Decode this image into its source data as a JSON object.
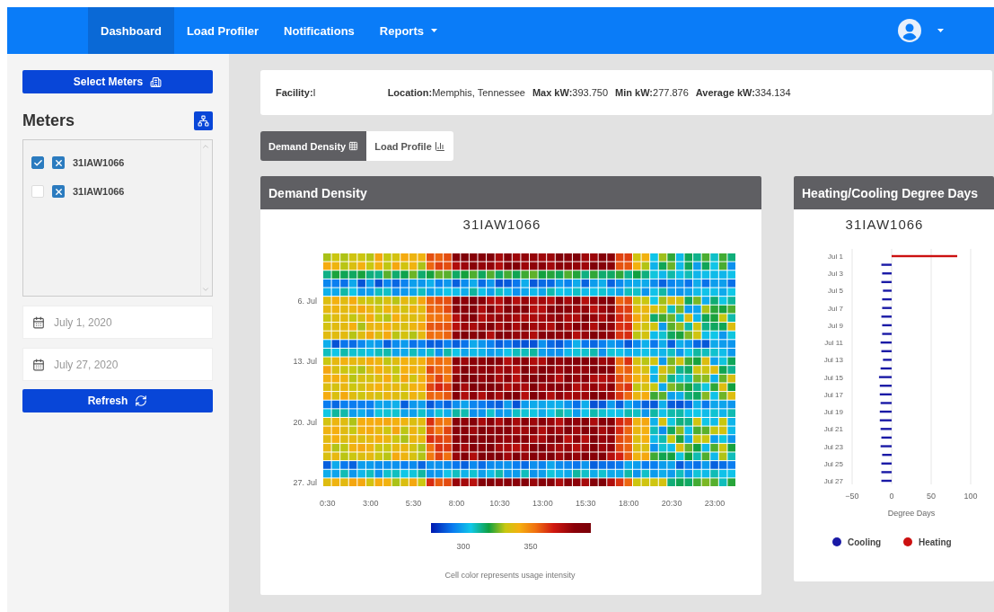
{
  "navbar": {
    "items": [
      {
        "label": "Dashboard",
        "selected": true,
        "has_menu": false
      },
      {
        "label": "Load Profiler",
        "selected": false,
        "has_menu": false
      },
      {
        "label": "Notifications",
        "selected": false,
        "has_menu": false
      },
      {
        "label": "Reports",
        "selected": false,
        "has_menu": true
      }
    ]
  },
  "sidebar": {
    "select_button": "Select Meters",
    "heading": "Meters",
    "meters": [
      {
        "label": "31IAW1066",
        "checked": true
      },
      {
        "label": "31IAW1066",
        "checked": false
      }
    ],
    "start_date": "July 1, 2020",
    "end_date": "July 27, 2020",
    "refresh_button": "Refresh"
  },
  "info": [
    {
      "label": "Facility:",
      "value": "I"
    },
    {
      "label": "Location:",
      "value": "Memphis, Tennessee"
    },
    {
      "label": "Max kW:",
      "value": "393.750"
    },
    {
      "label": "Min kW:",
      "value": "277.876"
    },
    {
      "label": "Average kW:",
      "value": "334.134"
    }
  ],
  "tabs": [
    {
      "label": "Demand Density",
      "selected": true
    },
    {
      "label": "Load Profile",
      "selected": false
    }
  ],
  "demand_density": {
    "header": "Demand Density",
    "title": "31IAW1066",
    "y_labels": [
      "6. Jul",
      "13. Jul",
      "20. Jul",
      "27. Jul"
    ],
    "x_labels": [
      "0:30",
      "3:00",
      "5:30",
      "8:00",
      "10:30",
      "13:00",
      "15:30",
      "18:00",
      "20:30",
      "23:00"
    ],
    "scale_labels": [
      "300",
      "350"
    ],
    "caption": "Cell color represents usage intensity"
  },
  "degree_days": {
    "header": "Heating/Cooling Degree Days",
    "title": "31IAW1066",
    "chart_data": {
      "type": "bar",
      "orientation": "horizontal",
      "xlabel": "Degree Days",
      "grid": true,
      "legend": true,
      "categories": [
        "Jul 1",
        null,
        "Jul 3",
        null,
        "Jul 5",
        null,
        "Jul 7",
        null,
        "Jul 9",
        null,
        "Jul 11",
        null,
        "Jul 13",
        null,
        "Jul 15",
        null,
        "Jul 17",
        null,
        "Jul 19",
        null,
        "Jul 21",
        null,
        "Jul 23",
        null,
        "Jul 25",
        null,
        "Jul 27"
      ],
      "series": [
        {
          "name": "Cooling",
          "color": "#1a1aa6",
          "values": [
            null,
            -13,
            -12,
            -13,
            -11,
            -12,
            -12,
            -13,
            -12,
            -12,
            -14,
            -13,
            -11,
            -14,
            -16,
            -15,
            -15,
            -14,
            -15,
            -15,
            -14,
            -13,
            -14,
            -12,
            -13,
            -13,
            -13
          ]
        },
        {
          "name": "Heating",
          "color": "#cc1111",
          "values": [
            83,
            null,
            null,
            null,
            null,
            null,
            null,
            null,
            null,
            null,
            null,
            null,
            null,
            null,
            null,
            null,
            null,
            null,
            null,
            null,
            null,
            null,
            null,
            null,
            null,
            null,
            null
          ]
        }
      ],
      "xlim": [
        -50,
        100
      ],
      "xticks": [
        -50,
        0,
        50,
        100
      ]
    }
  }
}
